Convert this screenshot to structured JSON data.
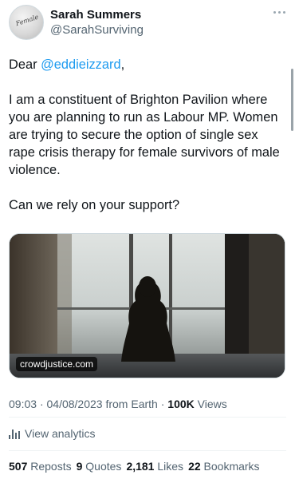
{
  "author": {
    "name": "Sarah Summers",
    "handle": "@SarahSurviving",
    "avatar_text": "Female"
  },
  "tweet": {
    "greeting_prefix": "Dear ",
    "mention": "@eddieizzard",
    "greeting_suffix": ",",
    "paragraph1": "I am a constituent of Brighton Pavilion where you are planning to run as Labour MP. Women are trying to secure the option of single sex rape crisis therapy for female survivors of male violence.",
    "paragraph2": "Can we rely on your support?"
  },
  "media": {
    "badge": "crowdjustice.com"
  },
  "meta": {
    "time": "09:03",
    "date": "04/08/2023",
    "source": "from Earth",
    "views_count": "100K",
    "views_label": "Views"
  },
  "analytics": {
    "label": "View analytics"
  },
  "stats": {
    "reposts_count": "507",
    "reposts_label": "Reposts",
    "quotes_count": "9",
    "quotes_label": "Quotes",
    "likes_count": "2,181",
    "likes_label": "Likes",
    "bookmarks_count": "22",
    "bookmarks_label": "Bookmarks"
  },
  "colors": {
    "link": "#1d9bf0",
    "secondary_text": "#536471",
    "primary_text": "#0f1419"
  },
  "icons": {
    "more": "more-dots-icon",
    "analytics": "bar-chart-icon"
  }
}
